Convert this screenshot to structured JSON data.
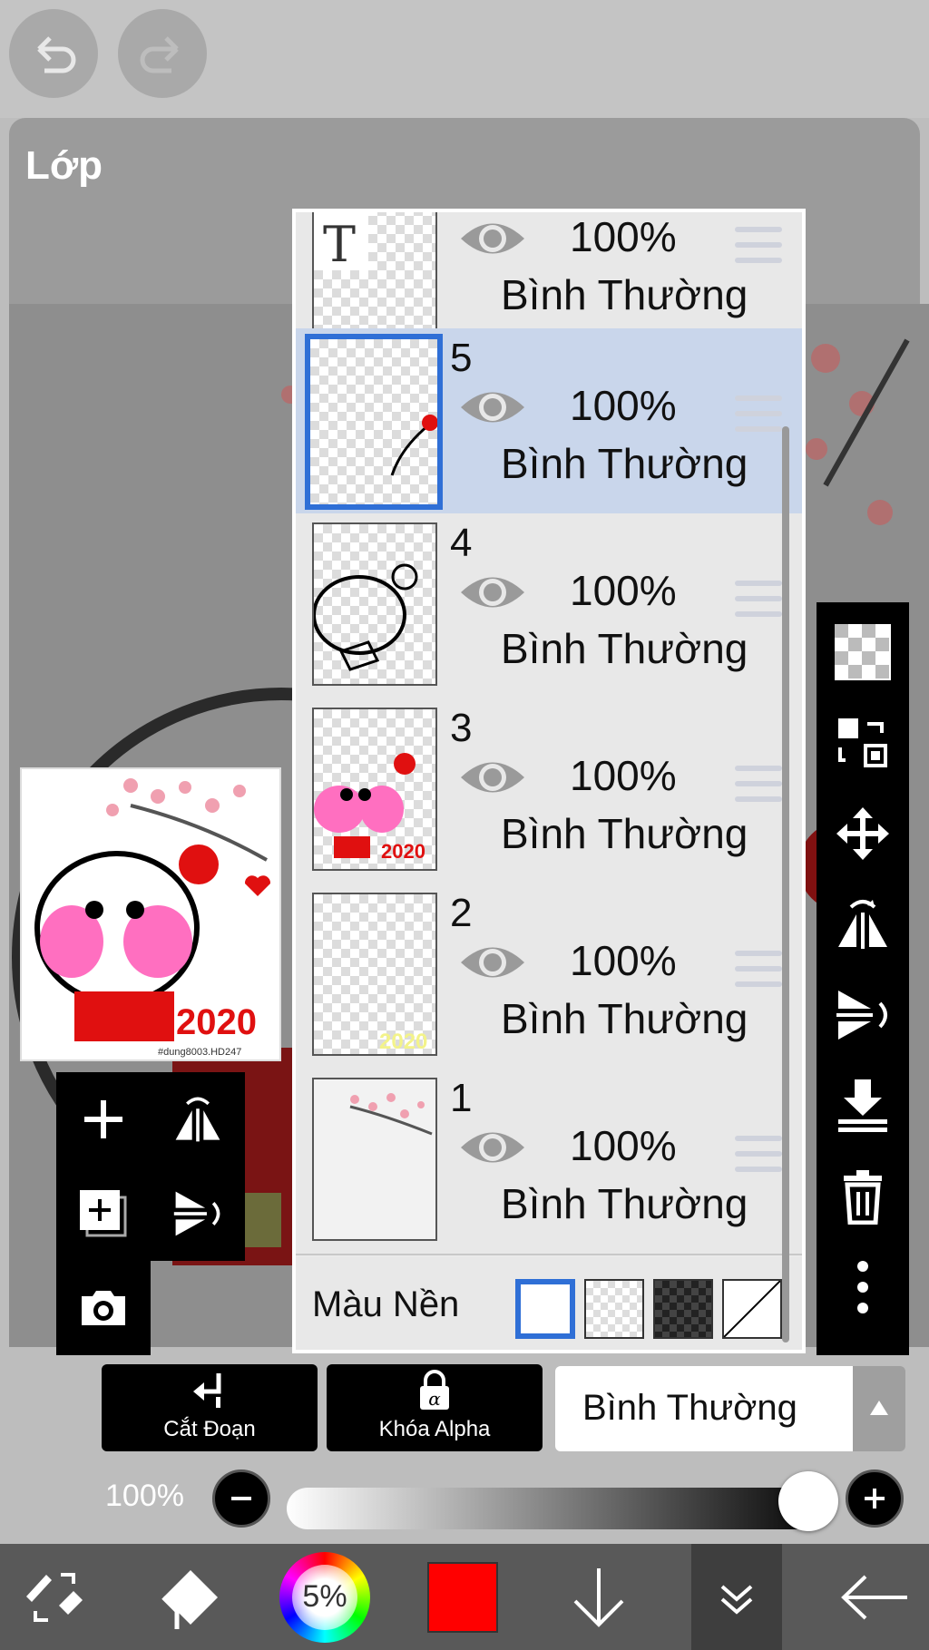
{
  "panel": {
    "title": "Lớp"
  },
  "layers": [
    {
      "number": "",
      "opacity": "100%",
      "mode": "Bình Thường",
      "selected": false,
      "kind": "text"
    },
    {
      "number": "5",
      "opacity": "100%",
      "mode": "Bình Thường",
      "selected": true
    },
    {
      "number": "4",
      "opacity": "100%",
      "mode": "Bình Thường",
      "selected": false
    },
    {
      "number": "3",
      "opacity": "100%",
      "mode": "Bình Thường",
      "selected": false
    },
    {
      "number": "2",
      "opacity": "100%",
      "mode": "Bình Thường",
      "selected": false
    },
    {
      "number": "1",
      "opacity": "100%",
      "mode": "Bình Thường",
      "selected": false
    }
  ],
  "text_layer_thumb_letter": "T",
  "background": {
    "label": "Màu Nền",
    "selected": "white"
  },
  "thumb_texts": {
    "year": "2020",
    "signature": "#dung8003.HD247"
  },
  "controls": {
    "clipping_label": "Cắt Đoạn",
    "alpha_lock_label": "Khóa Alpha",
    "blend_mode": "Bình Thường",
    "opacity_label": "100%",
    "opacity_value": 1.0
  },
  "bottom_nav": {
    "brush_size": "5%",
    "current_color": "#ff0000"
  },
  "colors": {
    "accent": "#2f6fd6",
    "selected_row": "#c9d6eb",
    "toolbar": "#000000"
  },
  "icons": [
    "undo-icon",
    "redo-icon",
    "eye-icon",
    "drag-handle-icon",
    "transparent-icon",
    "move-to-layer-icon",
    "move-icon",
    "flip-horizontal-icon",
    "flip-vertical-icon",
    "merge-down-icon",
    "trash-icon",
    "more-icon",
    "add-layer-icon",
    "duplicate-layer-icon",
    "camera-icon",
    "clipping-icon",
    "lock-icon",
    "chevron-up-icon",
    "minus-icon",
    "plus-icon",
    "tool-switch-icon",
    "eraser-icon",
    "color-wheel-icon",
    "arrow-down-icon",
    "collapse-icon",
    "back-arrow-icon"
  ]
}
